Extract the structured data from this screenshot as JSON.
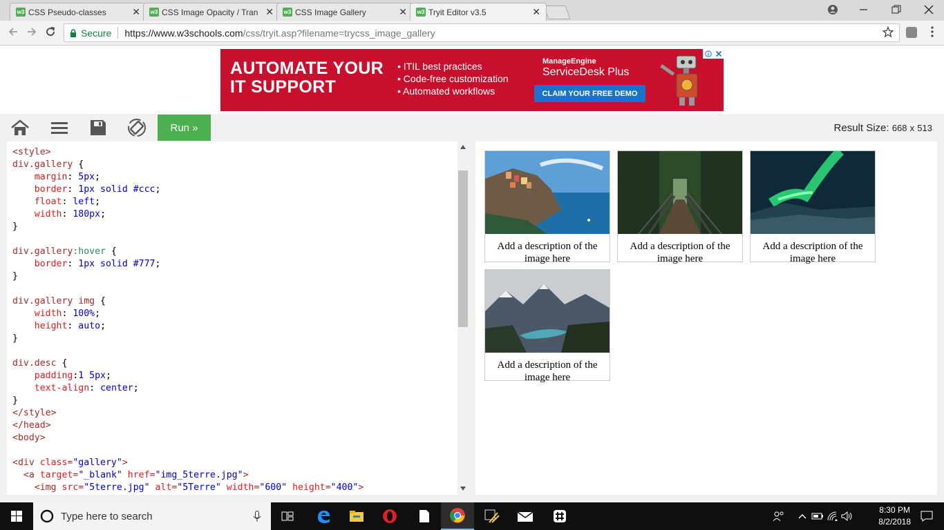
{
  "browser": {
    "tabs": [
      {
        "favicon": "w3",
        "title": "CSS Pseudo-classes",
        "active": false
      },
      {
        "favicon": "w3",
        "title": "CSS Image Opacity / Tran",
        "active": false
      },
      {
        "favicon": "w3",
        "title": "CSS Image Gallery",
        "active": false
      },
      {
        "favicon": "w3",
        "title": "Tryit Editor v3.5",
        "active": true
      }
    ],
    "close_glyph": "✕",
    "address": {
      "secure_label": "Secure",
      "url_host": "https://www.w3schools.com",
      "url_path": "/css/tryit.asp?filename=trycss_image_gallery"
    }
  },
  "ad": {
    "headline_line1": "AUTOMATE YOUR",
    "headline_line2": "IT SUPPORT",
    "bullets": [
      "ITIL best practices",
      "Code-free customization",
      "Automated workflows"
    ],
    "brand": "ManageEngine",
    "product": "ServiceDesk Plus",
    "cta": "CLAIM YOUR FREE DEMO",
    "accent_color": "#c8102e"
  },
  "toolbar": {
    "run_label": "Run »",
    "result_size_label": "Result Size:",
    "result_width": "668",
    "result_x": "x",
    "result_height": "513",
    "run_color": "#4caf50"
  },
  "code_lines": [
    [
      [
        "t-tag",
        "<style>"
      ]
    ],
    [
      [
        "t-sel",
        "div.gallery"
      ],
      [
        "t-pun",
        " {"
      ]
    ],
    [
      [
        "t-pun",
        "    "
      ],
      [
        "t-prop",
        "margin"
      ],
      [
        "t-pun",
        ": "
      ],
      [
        "t-val",
        "5px"
      ],
      [
        "t-pun",
        ";"
      ]
    ],
    [
      [
        "t-pun",
        "    "
      ],
      [
        "t-prop",
        "border"
      ],
      [
        "t-pun",
        ": "
      ],
      [
        "t-val",
        "1px solid #ccc"
      ],
      [
        "t-pun",
        ";"
      ]
    ],
    [
      [
        "t-pun",
        "    "
      ],
      [
        "t-prop",
        "float"
      ],
      [
        "t-pun",
        ": "
      ],
      [
        "t-val",
        "left"
      ],
      [
        "t-pun",
        ";"
      ]
    ],
    [
      [
        "t-pun",
        "    "
      ],
      [
        "t-prop",
        "width"
      ],
      [
        "t-pun",
        ": "
      ],
      [
        "t-val",
        "180px"
      ],
      [
        "t-pun",
        ";"
      ]
    ],
    [
      [
        "t-pun",
        "}"
      ]
    ],
    [
      [
        "t-pun",
        ""
      ]
    ],
    [
      [
        "t-sel",
        "div.gallery"
      ],
      [
        "t-pseudo",
        ":hover"
      ],
      [
        "t-pun",
        " {"
      ]
    ],
    [
      [
        "t-pun",
        "    "
      ],
      [
        "t-prop",
        "border"
      ],
      [
        "t-pun",
        ": "
      ],
      [
        "t-val",
        "1px solid #777"
      ],
      [
        "t-pun",
        ";"
      ]
    ],
    [
      [
        "t-pun",
        "}"
      ]
    ],
    [
      [
        "t-pun",
        ""
      ]
    ],
    [
      [
        "t-sel",
        "div.gallery img"
      ],
      [
        "t-pun",
        " {"
      ]
    ],
    [
      [
        "t-pun",
        "    "
      ],
      [
        "t-prop",
        "width"
      ],
      [
        "t-pun",
        ": "
      ],
      [
        "t-val",
        "100%"
      ],
      [
        "t-pun",
        ";"
      ]
    ],
    [
      [
        "t-pun",
        "    "
      ],
      [
        "t-prop",
        "height"
      ],
      [
        "t-pun",
        ": "
      ],
      [
        "t-val",
        "auto"
      ],
      [
        "t-pun",
        ";"
      ]
    ],
    [
      [
        "t-pun",
        "}"
      ]
    ],
    [
      [
        "t-pun",
        ""
      ]
    ],
    [
      [
        "t-sel",
        "div.desc"
      ],
      [
        "t-pun",
        " {"
      ]
    ],
    [
      [
        "t-pun",
        "    "
      ],
      [
        "t-prop",
        "padding"
      ],
      [
        "t-pun",
        ":"
      ],
      [
        "t-val",
        "1 5px"
      ],
      [
        "t-pun",
        ";"
      ]
    ],
    [
      [
        "t-pun",
        "    "
      ],
      [
        "t-prop",
        "text-align"
      ],
      [
        "t-pun",
        ": "
      ],
      [
        "t-val",
        "center"
      ],
      [
        "t-pun",
        ";"
      ]
    ],
    [
      [
        "t-pun",
        "}"
      ]
    ],
    [
      [
        "t-tag",
        "</style>"
      ]
    ],
    [
      [
        "t-tag",
        "</head>"
      ]
    ],
    [
      [
        "t-tag",
        "<body>"
      ]
    ],
    [
      [
        "t-pun",
        ""
      ]
    ],
    [
      [
        "t-tag",
        "<div "
      ],
      [
        "t-attr",
        "class"
      ],
      [
        "t-tag",
        "="
      ],
      [
        "t-str",
        "\"gallery\""
      ],
      [
        "t-tag",
        ">"
      ]
    ],
    [
      [
        "t-pun",
        "  "
      ],
      [
        "t-tag",
        "<a "
      ],
      [
        "t-attr",
        "target"
      ],
      [
        "t-tag",
        "="
      ],
      [
        "t-str",
        "\"_blank\""
      ],
      [
        "t-tag",
        " "
      ],
      [
        "t-attr",
        "href"
      ],
      [
        "t-tag",
        "="
      ],
      [
        "t-str",
        "\"img_5terre.jpg\""
      ],
      [
        "t-tag",
        ">"
      ]
    ],
    [
      [
        "t-pun",
        "    "
      ],
      [
        "t-tag",
        "<img "
      ],
      [
        "t-attr",
        "src"
      ],
      [
        "t-tag",
        "="
      ],
      [
        "t-str",
        "\"5terre.jpg\""
      ],
      [
        "t-tag",
        " "
      ],
      [
        "t-attr",
        "alt"
      ],
      [
        "t-tag",
        "="
      ],
      [
        "t-str",
        "\"5Terre\""
      ],
      [
        "t-tag",
        " "
      ],
      [
        "t-attr",
        "width"
      ],
      [
        "t-tag",
        "="
      ],
      [
        "t-str",
        "\"600\""
      ],
      [
        "t-tag",
        " "
      ],
      [
        "t-attr",
        "height"
      ],
      [
        "t-tag",
        "="
      ],
      [
        "t-str",
        "\"400\""
      ],
      [
        "t-tag",
        ">"
      ]
    ]
  ],
  "gallery": [
    {
      "image": "cinque-terre-coast",
      "desc": "Add a description of the image here"
    },
    {
      "image": "forest-bridge",
      "desc": "Add a description of the image here"
    },
    {
      "image": "northern-lights",
      "desc": "Add a description of the image here"
    },
    {
      "image": "mountain-lake",
      "desc": "Add a description of the image here"
    }
  ],
  "taskbar": {
    "search_placeholder": "Type here to search",
    "time": "8:30 PM",
    "date": "8/2/2018"
  }
}
